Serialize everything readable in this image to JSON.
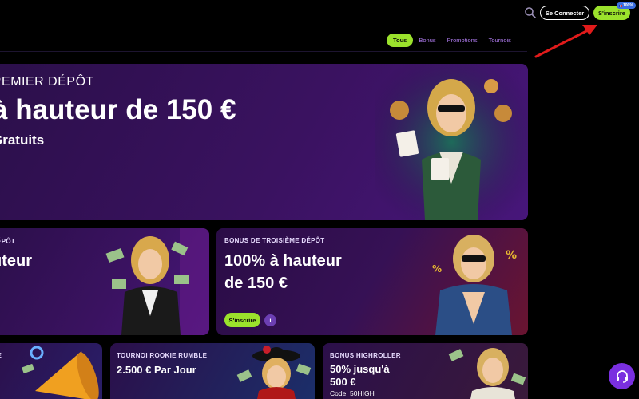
{
  "header": {
    "search_icon": "search-icon",
    "login_label": "Se Connecter",
    "signup_label": "S'inscrire",
    "badge_label": "100%",
    "accent_color": "#9be22c"
  },
  "tabs": [
    {
      "label": "Tous",
      "active": true
    },
    {
      "label": "Bonus",
      "active": false
    },
    {
      "label": "Promotions",
      "active": false
    },
    {
      "label": "Tournois",
      "active": false
    }
  ],
  "hero": {
    "kicker": "REMIER DÉPÔT",
    "headline": "à hauteur de 150 €",
    "subline": "Gratuits"
  },
  "cards": {
    "second": {
      "kicker": "DÉPÔT",
      "title": "uteur"
    },
    "third": {
      "kicker": "BONUS DE TROISIÈME DÉPÔT",
      "title_line1": "100% à hauteur",
      "title_line2": "de 150 €",
      "signup_label": "S'inscrire",
      "info_label": "i"
    },
    "fourth": {
      "kicker": "GE"
    },
    "fifth": {
      "kicker": "TOURNOI ROOKIE RUMBLE",
      "title": "2.500 € Par Jour"
    },
    "sixth": {
      "kicker": "BONUS HIGHROLLER",
      "title_line1": "50% jusqu'à",
      "title_line2": "500 €",
      "code": "Code: 50HIGH"
    }
  },
  "chat": {
    "icon": "headset-icon"
  }
}
